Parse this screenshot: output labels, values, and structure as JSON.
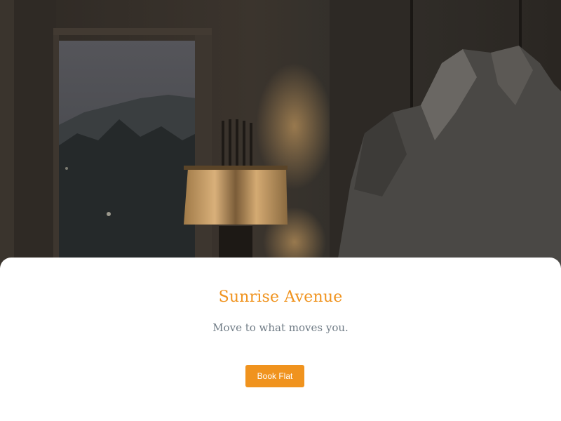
{
  "hero": {
    "image": "dark-interior-room-with-window-lamp-and-stone-sculpture"
  },
  "card": {
    "title": "Sunrise Avenue",
    "tagline": "Move to what moves you.",
    "cta_label": "Book Flat"
  },
  "colors": {
    "accent": "#f0931e",
    "tagline": "#6f7b85",
    "card_bg": "#ffffff"
  }
}
